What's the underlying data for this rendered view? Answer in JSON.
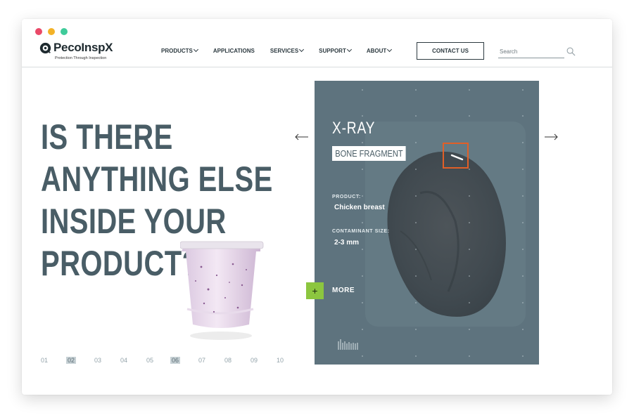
{
  "logo": {
    "name": "PecoInspX",
    "tagline": "Protection Through Inspection"
  },
  "nav": {
    "items": [
      {
        "label": "PRODUCTS",
        "has_dropdown": true
      },
      {
        "label": "APPLICATIONS",
        "has_dropdown": false
      },
      {
        "label": "SERVICES",
        "has_dropdown": true
      },
      {
        "label": "SUPPORT",
        "has_dropdown": true
      },
      {
        "label": "ABOUT",
        "has_dropdown": true
      }
    ],
    "contact_label": "CONTACT US",
    "search_placeholder": "Search"
  },
  "hero": {
    "title_lines": [
      "IS THERE",
      "ANYTHING ELSE",
      "INSIDE YOUR",
      "PRODUCT?"
    ]
  },
  "pager": {
    "pages": [
      "01",
      "02",
      "03",
      "04",
      "05",
      "06",
      "07",
      "08",
      "09",
      "10"
    ],
    "highlighted": [
      "02",
      "06"
    ]
  },
  "card": {
    "title": "X-RAY",
    "badge": "BONE FRAGMENT",
    "product_label": "PRODUCT:",
    "product_value": "Chicken breast",
    "size_label": "CONTAMINANT SIZE:",
    "size_value": "2-3 mm",
    "more_label": "MORE",
    "more_symbol": "+"
  },
  "colors": {
    "heading": "#495d66",
    "card_bg": "#5e737e",
    "accent_green": "#8cc63f",
    "detect_orange": "#e15f27",
    "traffic_red": "#ea4968",
    "traffic_yellow": "#f3b227",
    "traffic_green": "#3fcb9a"
  },
  "icons": [
    "window-close-dot",
    "window-minimize-dot",
    "window-maximize-dot",
    "logo-mark-icon",
    "chevron-down-icon",
    "search-icon",
    "arrow-left-icon",
    "arrow-right-icon",
    "plus-icon",
    "barcode-icon"
  ]
}
